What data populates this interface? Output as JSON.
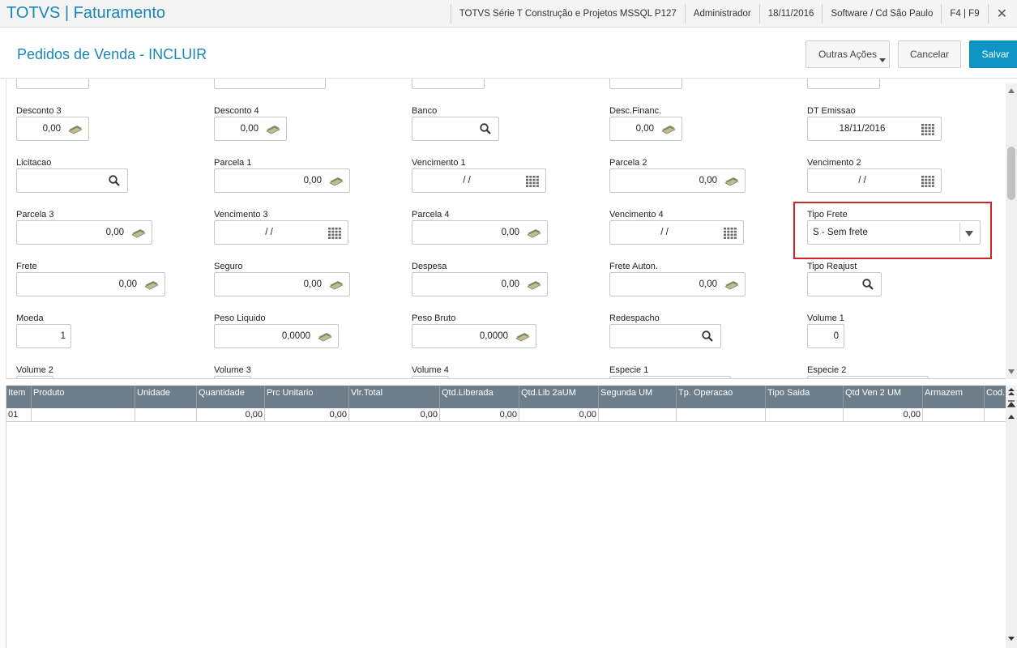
{
  "topbar": {
    "app_title": "TOTVS | Faturamento",
    "environment": "TOTVS Série T Construção e Projetos MSSQL P127",
    "user": "Administrador",
    "date": "18/11/2016",
    "branch": "Software / Cd São Paulo",
    "shortcuts": "F4 | F9",
    "close": "✕"
  },
  "header": {
    "page_title": "Pedidos de Venda - INCLUIR",
    "other_actions": "Outras Ações",
    "cancel": "Cancelar",
    "save": "Salvar"
  },
  "form": {
    "desconto3": {
      "label": "Desconto 3",
      "value": "0,00"
    },
    "desconto4": {
      "label": "Desconto 4",
      "value": "0,00"
    },
    "banco": {
      "label": "Banco",
      "value": ""
    },
    "desc_financ": {
      "label": "Desc.Financ.",
      "value": "0,00"
    },
    "dt_emissao": {
      "label": "DT Emissao",
      "value": "18/11/2016"
    },
    "licitacao": {
      "label": "Licitacao",
      "value": ""
    },
    "parcela1": {
      "label": "Parcela 1",
      "value": "0,00"
    },
    "vencimento1": {
      "label": "Vencimento 1",
      "value": "/ /"
    },
    "parcela2": {
      "label": "Parcela 2",
      "value": "0,00"
    },
    "vencimento2": {
      "label": "Vencimento 2",
      "value": "/ /"
    },
    "parcela3": {
      "label": "Parcela 3",
      "value": "0,00"
    },
    "vencimento3": {
      "label": "Vencimento 3",
      "value": "/ /"
    },
    "parcela4": {
      "label": "Parcela 4",
      "value": "0,00"
    },
    "vencimento4": {
      "label": "Vencimento 4",
      "value": "/ /"
    },
    "tipo_frete": {
      "label": "Tipo Frete",
      "value": "S - Sem frete"
    },
    "frete": {
      "label": "Frete",
      "value": "0,00"
    },
    "seguro": {
      "label": "Seguro",
      "value": "0,00"
    },
    "despesa": {
      "label": "Despesa",
      "value": "0,00"
    },
    "frete_auton": {
      "label": "Frete Auton.",
      "value": "0,00"
    },
    "tipo_reajust": {
      "label": "Tipo Reajust",
      "value": ""
    },
    "moeda": {
      "label": "Moeda",
      "value": "1"
    },
    "peso_liquido": {
      "label": "Peso Liquido",
      "value": "0,0000"
    },
    "peso_bruto": {
      "label": "Peso Bruto",
      "value": "0,0000"
    },
    "redespacho": {
      "label": "Redespacho",
      "value": ""
    },
    "volume1": {
      "label": "Volume 1",
      "value": "0"
    },
    "volume2": {
      "label": "Volume 2"
    },
    "volume3": {
      "label": "Volume 3"
    },
    "volume4": {
      "label": "Volume 4"
    },
    "especie1": {
      "label": "Especie 1"
    },
    "especie2": {
      "label": "Especie 2"
    }
  },
  "grid": {
    "columns": [
      "Item",
      "Produto",
      "Unidade",
      "Quantidade",
      "Prc Unitario",
      "Vlr.Total",
      "Qtd.Liberada",
      "Qtd.Lib 2aUM",
      "Segunda UM",
      "Tp. Operacao",
      "Tipo Saida",
      "Qtd Ven 2 UM",
      "Armazem",
      "Cod."
    ],
    "rows": [
      [
        "01",
        "",
        "",
        "0,00",
        "0,00",
        "0,00",
        "0,00",
        "0,00",
        "",
        "",
        "",
        "0,00",
        "",
        ""
      ]
    ]
  }
}
